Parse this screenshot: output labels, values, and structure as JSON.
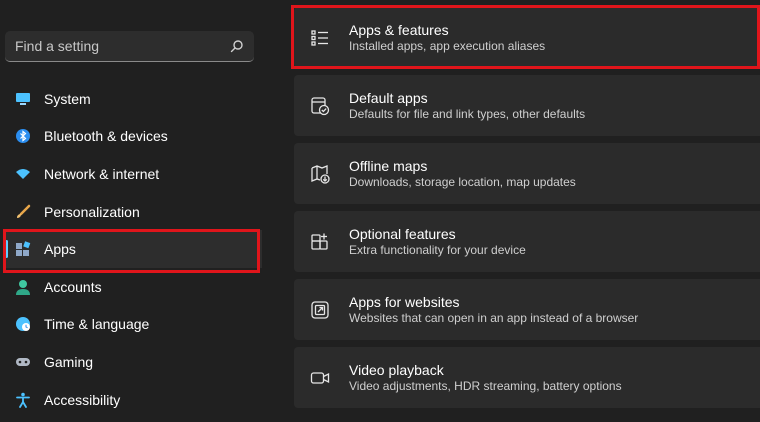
{
  "search": {
    "placeholder": "Find a setting",
    "icon": "search-icon"
  },
  "sidebar": {
    "items": [
      {
        "label": "System",
        "icon": "system-display-icon",
        "active": false
      },
      {
        "label": "Bluetooth & devices",
        "icon": "bluetooth-icon",
        "active": false
      },
      {
        "label": "Network & internet",
        "icon": "wifi-icon",
        "active": false
      },
      {
        "label": "Personalization",
        "icon": "paintbrush-icon",
        "active": false
      },
      {
        "label": "Apps",
        "icon": "apps-icon",
        "active": true
      },
      {
        "label": "Accounts",
        "icon": "account-icon",
        "active": false
      },
      {
        "label": "Time & language",
        "icon": "globe-clock-icon",
        "active": false
      },
      {
        "label": "Gaming",
        "icon": "gamepad-icon",
        "active": false
      },
      {
        "label": "Accessibility",
        "icon": "accessibility-icon",
        "active": false
      }
    ]
  },
  "cards": [
    {
      "title": "Apps & features",
      "description": "Installed apps, app execution aliases",
      "icon": "list-icon"
    },
    {
      "title": "Default apps",
      "description": "Defaults for file and link types, other defaults",
      "icon": "default-apps-icon"
    },
    {
      "title": "Offline maps",
      "description": "Downloads, storage location, map updates",
      "icon": "map-download-icon"
    },
    {
      "title": "Optional features",
      "description": "Extra functionality for your device",
      "icon": "optional-features-icon"
    },
    {
      "title": "Apps for websites",
      "description": "Websites that can open in an app instead of a browser",
      "icon": "open-link-icon"
    },
    {
      "title": "Video playback",
      "description": "Video adjustments, HDR streaming, battery options",
      "icon": "video-icon"
    }
  ],
  "colors": {
    "background": "#202020",
    "card": "#2b2b2b",
    "accent": "#60cdff",
    "highlight": "#e0151b"
  }
}
